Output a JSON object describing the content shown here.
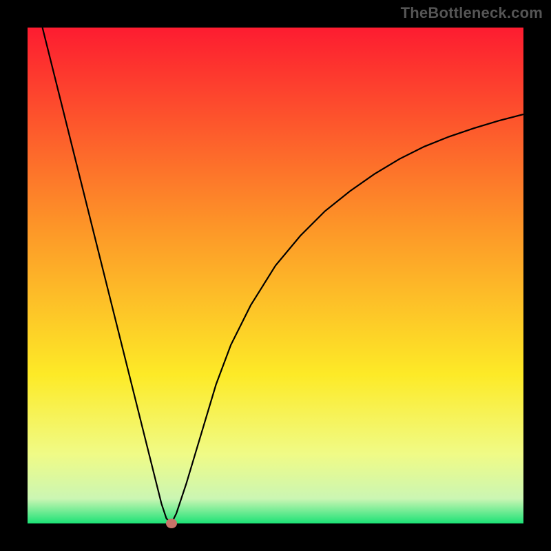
{
  "watermark": "TheBottleneck.com",
  "colors": {
    "frame": "#000000",
    "gradient_top": "#fd1c30",
    "gradient_mid1": "#fd9528",
    "gradient_mid2": "#fdea27",
    "gradient_mid3": "#f0fb86",
    "gradient_mid4": "#cbf6b3",
    "gradient_bottom": "#1ce276",
    "curve": "#000000",
    "marker": "#c77469"
  },
  "chart_data": {
    "type": "line",
    "title": "",
    "xlabel": "",
    "ylabel": "",
    "xlim": [
      0,
      100
    ],
    "ylim": [
      0,
      100
    ],
    "grid": false,
    "annotations": [
      {
        "text": "TheBottleneck.com",
        "pos": "top-right"
      }
    ],
    "series": [
      {
        "name": "bottleneck-curve",
        "x": [
          3,
          6,
          9,
          12,
          15,
          18,
          21,
          24,
          26,
          27,
          28,
          29,
          30,
          32,
          35,
          38,
          41,
          45,
          50,
          55,
          60,
          65,
          70,
          75,
          80,
          85,
          90,
          95,
          100
        ],
        "y": [
          100,
          88,
          76,
          64,
          52,
          40,
          28,
          16,
          8,
          4,
          1,
          0,
          2,
          8,
          18,
          28,
          36,
          44,
          52,
          58,
          63,
          67,
          70.5,
          73.5,
          76,
          78,
          79.7,
          81.2,
          82.5
        ]
      }
    ],
    "marker": {
      "x": 29,
      "y": 0
    }
  }
}
